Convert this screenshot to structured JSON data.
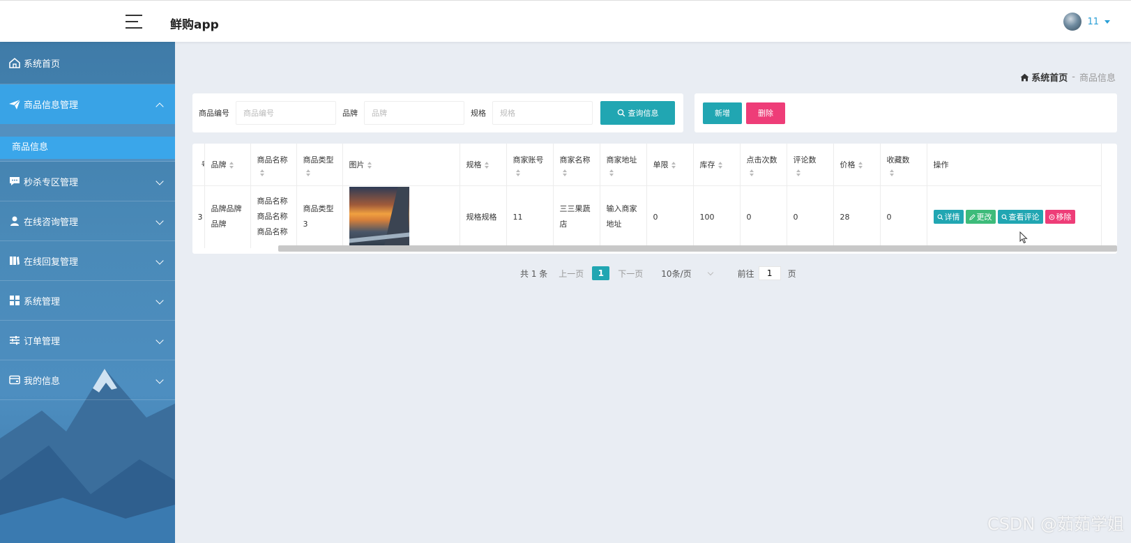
{
  "header": {
    "app_title": "鲜购app",
    "username": "11"
  },
  "sidebar": {
    "items": [
      {
        "label": "系统首页",
        "icon": "home-icon"
      },
      {
        "label": "商品信息管理",
        "icon": "paper-plane-icon",
        "open": true,
        "children": [
          {
            "label": "商品信息"
          }
        ]
      },
      {
        "label": "秒杀专区管理",
        "icon": "comment-icon"
      },
      {
        "label": "在线咨询管理",
        "icon": "user-icon"
      },
      {
        "label": "在线回复管理",
        "icon": "book-icon"
      },
      {
        "label": "系统管理",
        "icon": "grid-icon"
      },
      {
        "label": "订单管理",
        "icon": "sliders-icon"
      },
      {
        "label": "我的信息",
        "icon": "card-icon"
      }
    ]
  },
  "breadcrumb": {
    "home": "系统首页",
    "separator": "-",
    "current": "商品信息"
  },
  "search": {
    "fields": [
      {
        "label": "商品编号",
        "placeholder": "商品编号"
      },
      {
        "label": "品牌",
        "placeholder": "品牌"
      },
      {
        "label": "规格",
        "placeholder": "规格"
      }
    ],
    "query_label": "查询信息"
  },
  "actions": {
    "add_label": "新增",
    "delete_label": "删除"
  },
  "table": {
    "columns": [
      "号",
      "品牌",
      "商品名称",
      "商品类型",
      "图片",
      "规格",
      "商家账号",
      "商家名称",
      "商家地址",
      "单限",
      "库存",
      "点击次数",
      "评论数",
      "价格",
      "收藏数",
      "操作"
    ],
    "row": {
      "id": "3",
      "brand": "品牌品牌品牌",
      "name": "商品名称商品名称商品名称",
      "type": "商品类型3",
      "spec": "规格规格",
      "merchant_account": "11",
      "merchant_name": "三三果蔬店",
      "merchant_address": "输入商家地址",
      "limit": "0",
      "stock": "100",
      "clicks": "0",
      "comments": "0",
      "price": "28",
      "favorites": "0"
    },
    "ops": {
      "detail": "详情",
      "edit": "更改",
      "review": "查看评论",
      "remove": "移除"
    }
  },
  "pagination": {
    "total": "共 1 条",
    "prev": "上一页",
    "page": "1",
    "next": "下一页",
    "size": "10条/页",
    "goto": "前往",
    "goto_value": "1",
    "unit": "页"
  },
  "watermark": "CSDN @茹茹学姐",
  "colors": {
    "teal": "#21a6b2",
    "pink": "#ee3d78",
    "green": "#3dbb7a",
    "sidebar_active": "#39a3e6"
  }
}
